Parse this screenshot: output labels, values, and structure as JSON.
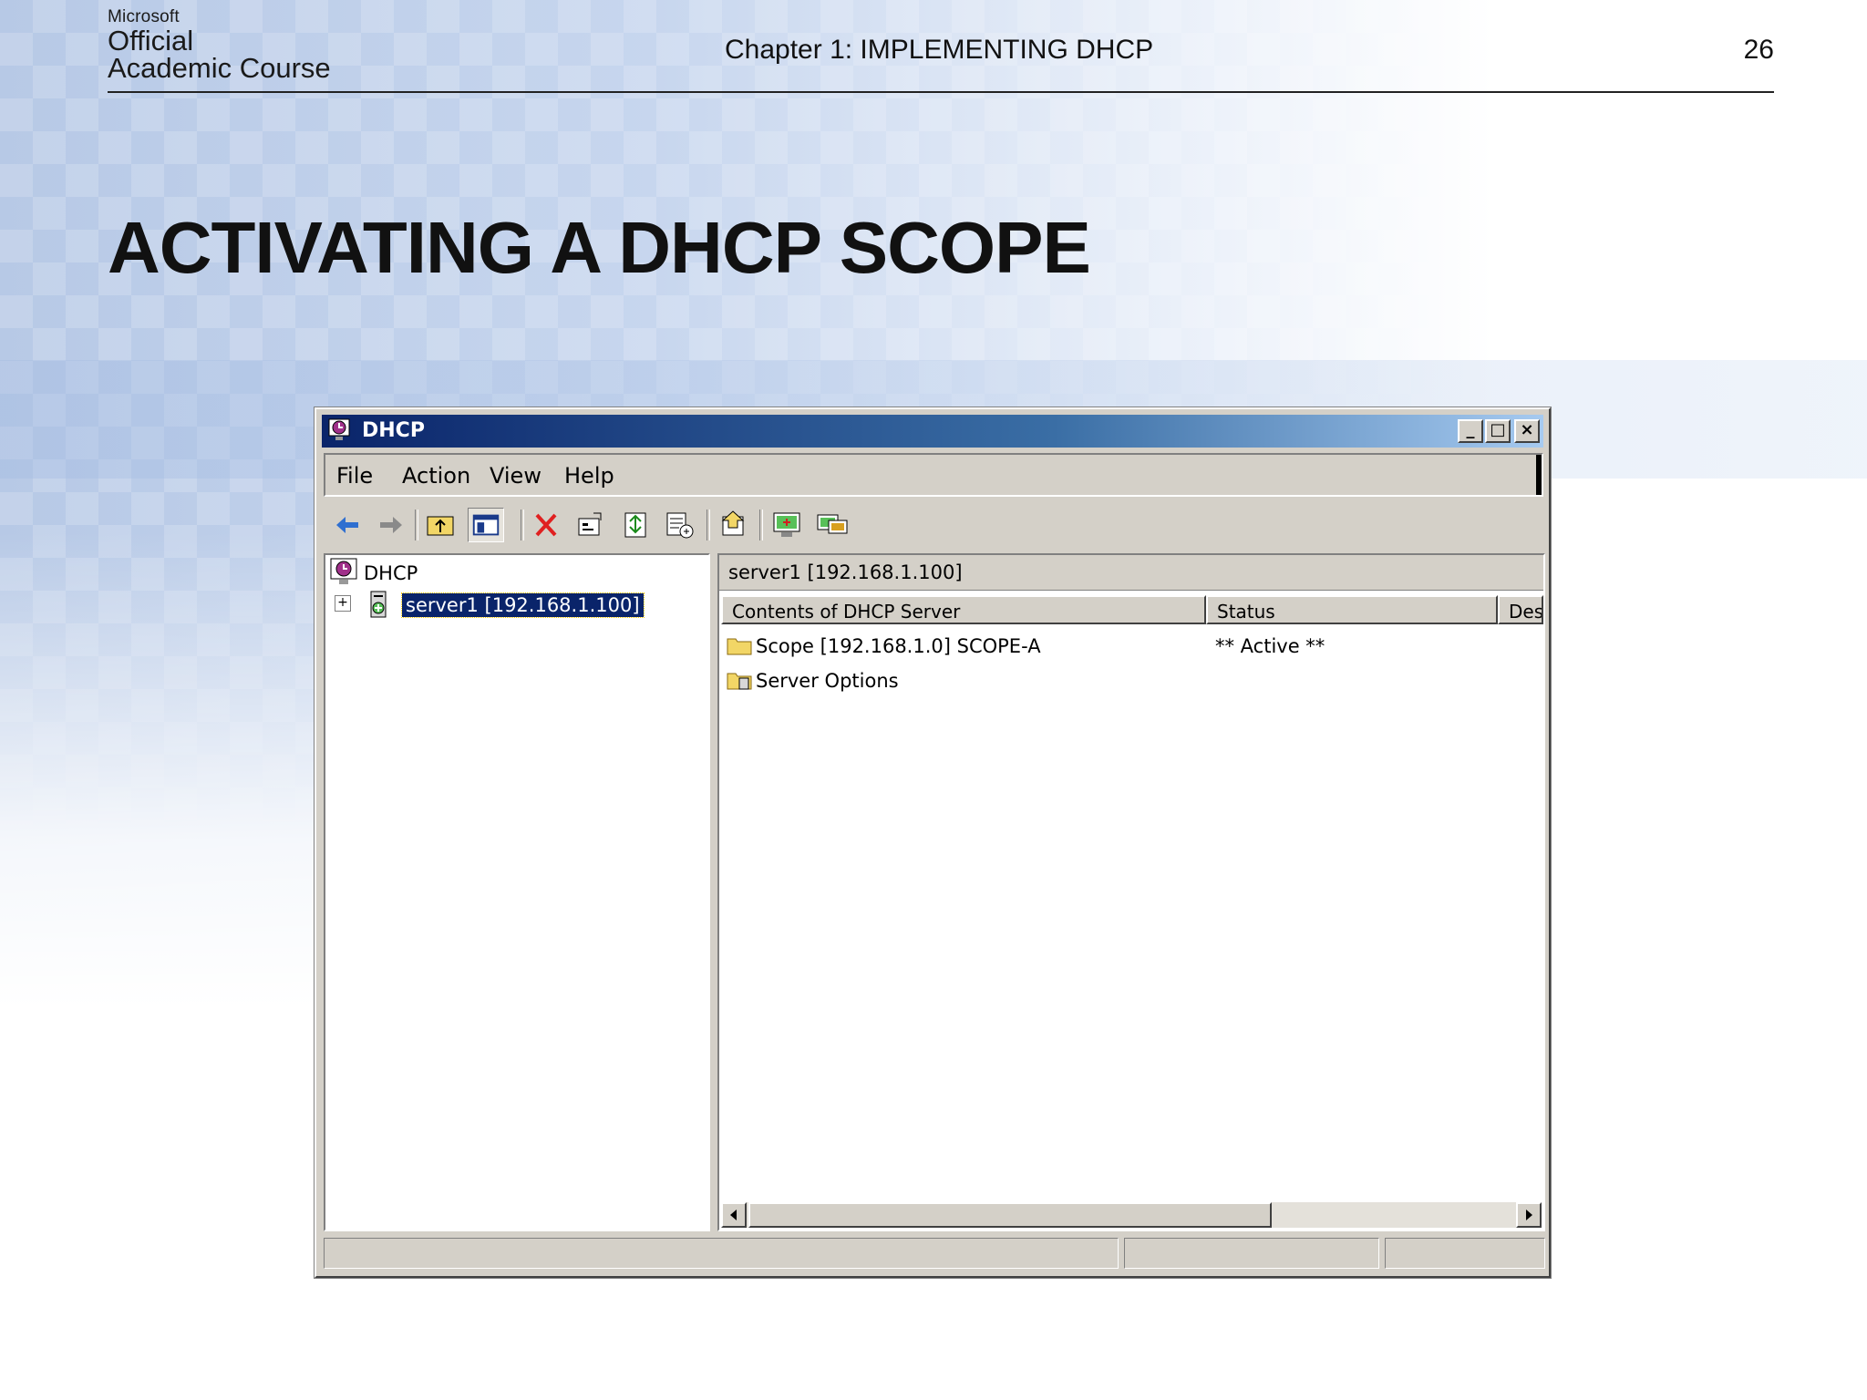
{
  "slide": {
    "logo": {
      "microsoft": "Microsoft",
      "line1": "Official",
      "line2": "Academic Course"
    },
    "chapter": "Chapter 1: IMPLEMENTING DHCP",
    "page_number": "26",
    "title": "ACTIVATING A DHCP SCOPE"
  },
  "window": {
    "title": "DHCP",
    "controls": {
      "minimize": "_",
      "maximize": "□",
      "close": "×"
    },
    "menu": [
      "File",
      "Action",
      "View",
      "Help"
    ],
    "toolbar": [
      "back-icon",
      "forward-icon",
      "up-folder-icon",
      "show-hide-tree-icon",
      "delete-icon",
      "properties-icon",
      "refresh-icon",
      "export-list-icon",
      "help-icon",
      "add-server-icon",
      "authorize-server-icon"
    ],
    "tree": {
      "root": "DHCP",
      "server": "server1 [192.168.1.100]",
      "expander": "+"
    },
    "details": {
      "path": "server1 [192.168.1.100]",
      "columns": [
        "Contents of DHCP Server",
        "Status",
        "Des"
      ],
      "rows": [
        {
          "name": "Scope [192.168.1.0] SCOPE-A",
          "status": "** Active **"
        },
        {
          "name": "Server Options",
          "status": ""
        }
      ]
    },
    "colors": {
      "titlebar_start": "#0a246a",
      "titlebar_end": "#a6caf0",
      "face": "#d4d0c8",
      "selection": "#0a246a",
      "folder": "#f2d666"
    }
  }
}
